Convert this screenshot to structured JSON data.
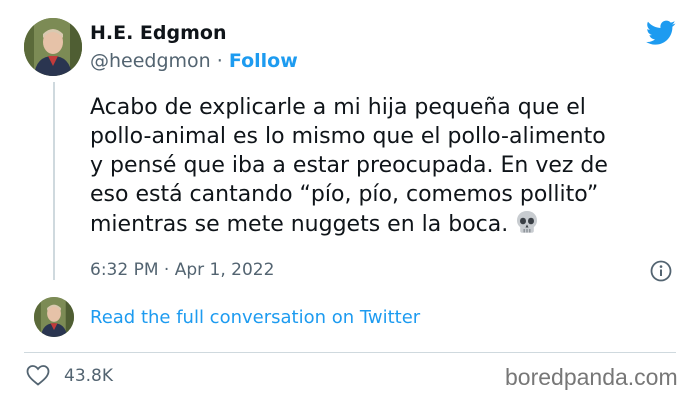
{
  "author": {
    "name": "H.E. Edgmon",
    "handle": "@heedgmon",
    "separator": "·",
    "follow_label": "Follow"
  },
  "tweet": {
    "lines": [
      "Acabo de explicarle a mi hija pequeña que el",
      "pollo-animal es lo mismo que el pollo-alimento",
      "y pensé que iba a estar preocupada. En vez de",
      "eso está cantando “pío, pío, comemos pollito”",
      "mientras se mete nuggets en la boca."
    ],
    "emoji": "skull-emoji",
    "timestamp": "6:32 PM · Apr 1, 2022"
  },
  "conversation": {
    "link_label": "Read the full conversation on Twitter"
  },
  "engagement": {
    "likes": "43.8K"
  },
  "watermark": "boredpanda.com",
  "colors": {
    "accent": "#1d9bf0",
    "text": "#0f1419",
    "muted": "#536471",
    "divider": "#cfd9de"
  },
  "icons": [
    "twitter-bird-icon",
    "info-icon",
    "heart-icon",
    "skull-emoji"
  ]
}
